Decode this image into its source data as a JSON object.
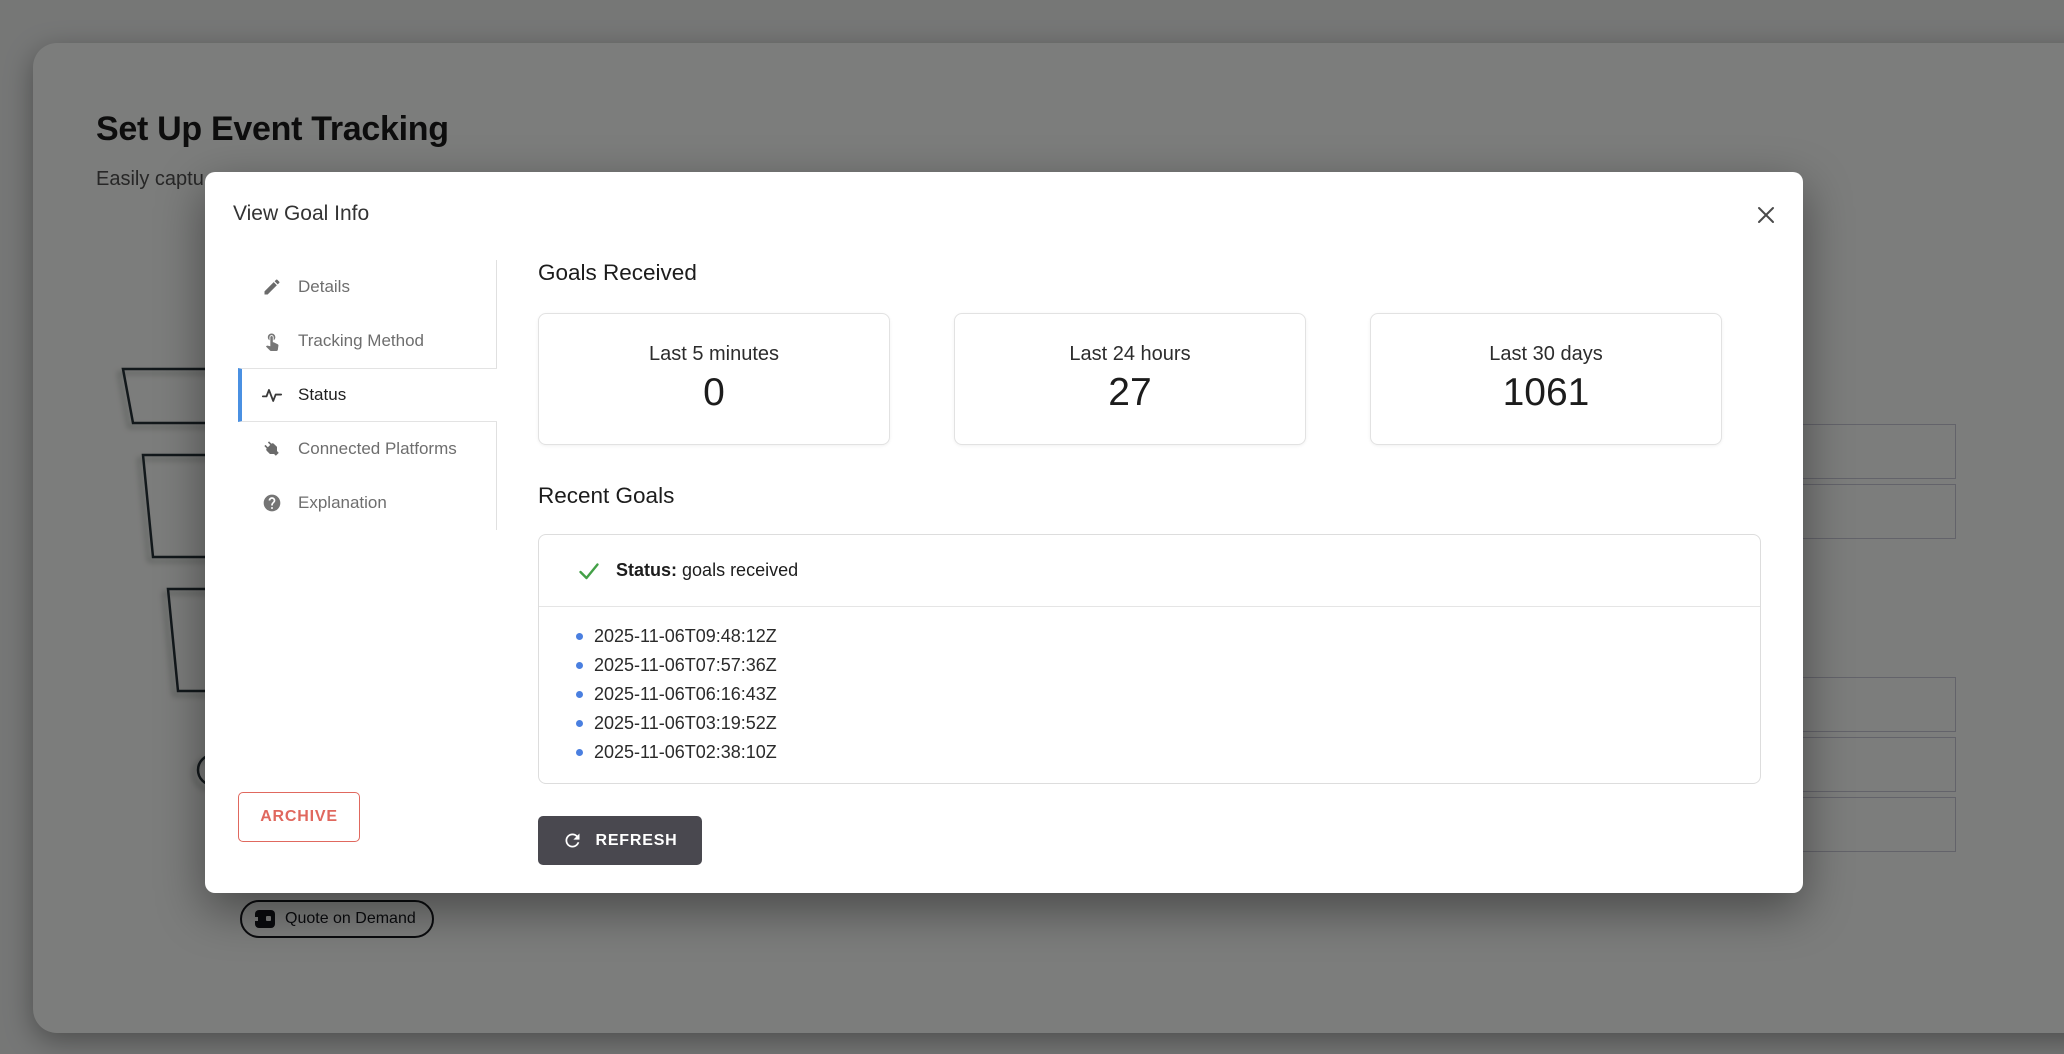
{
  "colors": {
    "accent_blue": "#4a90e2",
    "bullet_blue": "#4a7fe0",
    "success_green": "#43a047",
    "danger_red": "#e0685e",
    "dark_button": "#49484f"
  },
  "background": {
    "title": "Set Up Event Tracking",
    "subtitle_visible": "Easily captu",
    "badge_label": "Quote on Demand"
  },
  "modal": {
    "title": "View Goal Info",
    "sidebar": {
      "items": [
        {
          "label": "Details",
          "icon": "pencil-icon",
          "selected": false
        },
        {
          "label": "Tracking Method",
          "icon": "tap-icon",
          "selected": false
        },
        {
          "label": "Status",
          "icon": "pulse-icon",
          "selected": true
        },
        {
          "label": "Connected Platforms",
          "icon": "plug-icon",
          "selected": false
        },
        {
          "label": "Explanation",
          "icon": "question-icon",
          "selected": false
        }
      ]
    },
    "goals_received": {
      "heading": "Goals Received",
      "cards": [
        {
          "label": "Last 5 minutes",
          "value": "0"
        },
        {
          "label": "Last 24 hours",
          "value": "27"
        },
        {
          "label": "Last 30 days",
          "value": "1061"
        }
      ]
    },
    "recent_goals": {
      "heading": "Recent Goals",
      "status_label": "Status:",
      "status_value": "goals received",
      "timestamps": [
        "2025-11-06T09:48:12Z",
        "2025-11-06T07:57:36Z",
        "2025-11-06T06:16:43Z",
        "2025-11-06T03:19:52Z",
        "2025-11-06T02:38:10Z"
      ]
    },
    "actions": {
      "archive": "ARCHIVE",
      "refresh": "REFRESH"
    }
  }
}
